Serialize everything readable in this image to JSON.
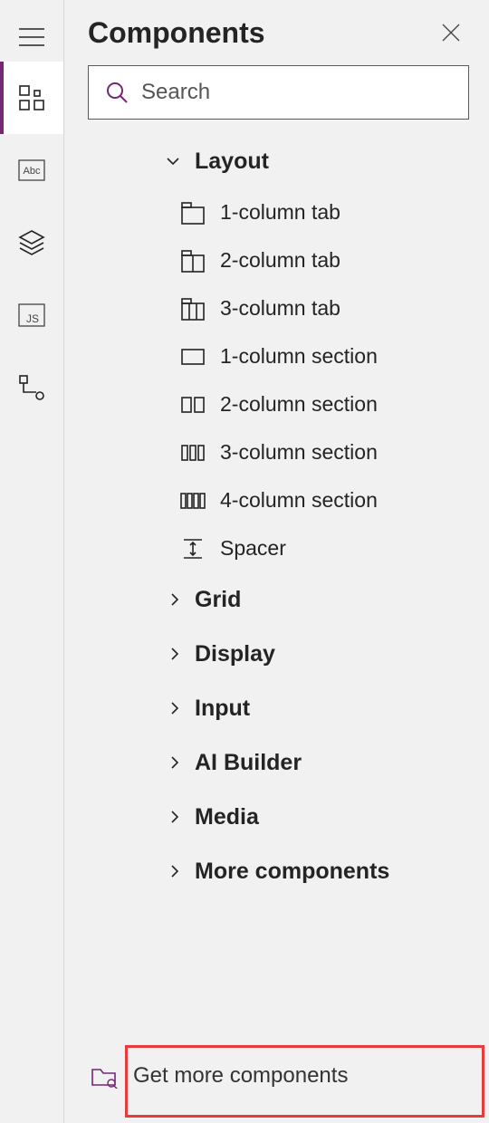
{
  "panel": {
    "title": "Components",
    "search": {
      "placeholder": "Search"
    },
    "footer": {
      "label": "Get more components"
    }
  },
  "groups": {
    "layout": {
      "label": "Layout",
      "expanded": true
    },
    "grid": {
      "label": "Grid"
    },
    "display": {
      "label": "Display"
    },
    "input": {
      "label": "Input"
    },
    "ai": {
      "label": "AI Builder"
    },
    "media": {
      "label": "Media"
    },
    "more": {
      "label": "More components"
    }
  },
  "layoutItems": {
    "c1tab": "1-column tab",
    "c2tab": "2-column tab",
    "c3tab": "3-column tab",
    "c1sec": "1-column section",
    "c2sec": "2-column section",
    "c3sec": "3-column section",
    "c4sec": "4-column section",
    "spacer": "Spacer"
  }
}
